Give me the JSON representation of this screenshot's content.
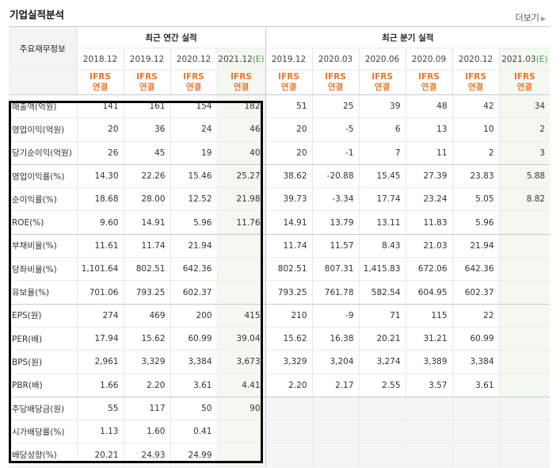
{
  "section_title": "기업실적분석",
  "more_link": "더보기",
  "header": {
    "row_label": "주요재무정보",
    "annual_title": "최근 연간 실적",
    "quarterly_title": "최근 분기 실적",
    "annual_periods": [
      "2018.12",
      "2019.12",
      "2020.12"
    ],
    "annual_est_period": "2021.12",
    "quarterly_periods": [
      "2019.12",
      "2020.03",
      "2020.06",
      "2020.09",
      "2020.12"
    ],
    "quarterly_est_period": "2021.03",
    "est_mark": "(E)",
    "ifrs": "IFRS",
    "basis": "연결"
  },
  "rows": [
    {
      "label": "매출액(억원)",
      "annual": [
        "141",
        "161",
        "154",
        "182"
      ],
      "quarterly": [
        "51",
        "25",
        "39",
        "48",
        "42",
        "34"
      ]
    },
    {
      "label": "영업이익(억원)",
      "annual": [
        "20",
        "36",
        "24",
        "46"
      ],
      "quarterly": [
        "20",
        "-5",
        "6",
        "13",
        "10",
        "2"
      ]
    },
    {
      "label": "당기순이익(억원)",
      "annual": [
        "26",
        "45",
        "19",
        "40"
      ],
      "quarterly": [
        "20",
        "-1",
        "7",
        "11",
        "2",
        "3"
      ]
    },
    {
      "label": "영업이익률(%)",
      "annual": [
        "14.30",
        "22.26",
        "15.46",
        "25.27"
      ],
      "quarterly": [
        "38.62",
        "-20.88",
        "15.45",
        "27.39",
        "23.83",
        "5.88"
      ]
    },
    {
      "label": "순이익률(%)",
      "annual": [
        "18.68",
        "28.00",
        "12.52",
        "21.98"
      ],
      "quarterly": [
        "39.73",
        "-3.34",
        "17.74",
        "23.24",
        "5.05",
        "8.82"
      ]
    },
    {
      "label": "ROE(%)",
      "annual": [
        "9.60",
        "14.91",
        "5.96",
        "11.76"
      ],
      "quarterly": [
        "14.91",
        "13.79",
        "13.11",
        "11.83",
        "5.96",
        ""
      ]
    },
    {
      "label": "부채비율(%)",
      "annual": [
        "11.61",
        "11.74",
        "21.94",
        ""
      ],
      "quarterly": [
        "11.74",
        "11.57",
        "8.43",
        "21.03",
        "21.94",
        ""
      ]
    },
    {
      "label": "당좌비율(%)",
      "annual": [
        "1,101.64",
        "802.51",
        "642.36",
        ""
      ],
      "quarterly": [
        "802.51",
        "807.31",
        "1,415.83",
        "672.06",
        "642.36",
        ""
      ]
    },
    {
      "label": "유보율(%)",
      "annual": [
        "701.06",
        "793.25",
        "602.37",
        ""
      ],
      "quarterly": [
        "793.25",
        "761.78",
        "582.54",
        "604.95",
        "602.37",
        ""
      ]
    },
    {
      "label": "EPS(원)",
      "annual": [
        "274",
        "469",
        "200",
        "415"
      ],
      "quarterly": [
        "210",
        "-9",
        "71",
        "115",
        "22",
        ""
      ]
    },
    {
      "label": "PER(배)",
      "annual": [
        "17.94",
        "15.62",
        "60.99",
        "39.04"
      ],
      "quarterly": [
        "15.62",
        "16.38",
        "20.21",
        "31.21",
        "60.99",
        ""
      ]
    },
    {
      "label": "BPS(원)",
      "annual": [
        "2,961",
        "3,329",
        "3,384",
        "3,673"
      ],
      "quarterly": [
        "3,329",
        "3,204",
        "3,274",
        "3,389",
        "3,384",
        ""
      ]
    },
    {
      "label": "PBR(배)",
      "annual": [
        "1.66",
        "2.20",
        "3.61",
        "4.41"
      ],
      "quarterly": [
        "2.20",
        "2.17",
        "2.55",
        "3.57",
        "3.61",
        ""
      ]
    },
    {
      "label": "주당배당금(원)",
      "annual": [
        "55",
        "117",
        "50",
        "90"
      ],
      "quarterly": [
        "",
        "",
        "",
        "",
        "",
        ""
      ]
    },
    {
      "label": "시가배당률(%)",
      "annual": [
        "1.13",
        "1.60",
        "0.41",
        ""
      ],
      "quarterly": [
        "",
        "",
        "",
        "",
        "",
        ""
      ]
    },
    {
      "label": "배당성향(%)",
      "annual": [
        "20.21",
        "24.93",
        "24.99",
        ""
      ],
      "quarterly": [
        "",
        "",
        "",
        "",
        "",
        ""
      ]
    }
  ],
  "colors": {
    "ifrs": "#e8762d",
    "negative": "#e32d2d",
    "estimate_bg": "#f3f8f1",
    "estimate_text": "#4a9b4a",
    "highlight_box": "#000000"
  }
}
